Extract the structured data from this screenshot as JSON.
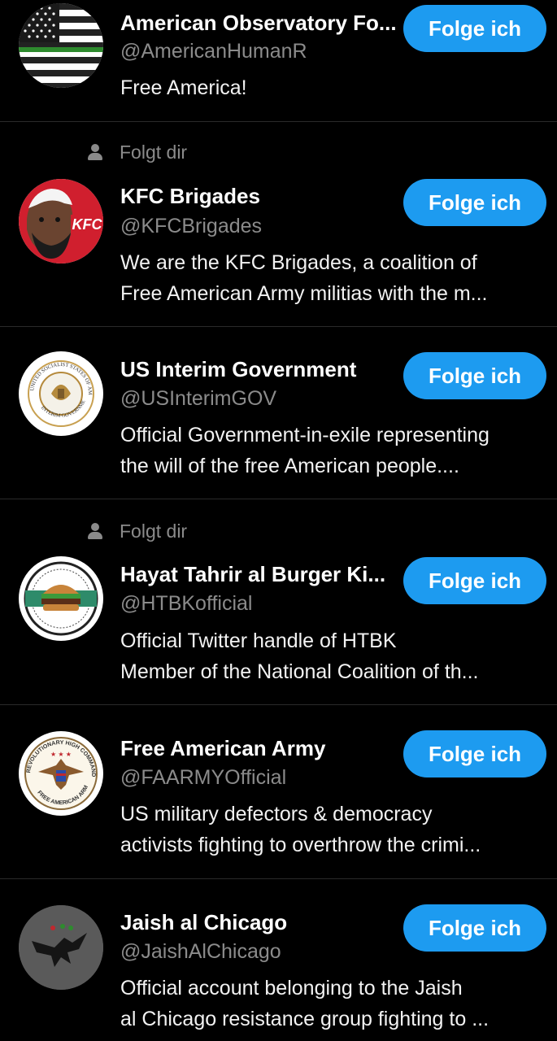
{
  "follows_you_label": "Folgt dir",
  "colors": {
    "background": "#000000",
    "button": "#1d9bf0",
    "secondary_text": "#8b8b8b",
    "divider": "#2a2a2a"
  },
  "accounts": [
    {
      "name": "American Observatory Fo...",
      "handle": "@AmericanHumanR",
      "bio": [
        "Free America!"
      ],
      "follows_you": false,
      "button_label": "Folge ich",
      "avatar_icon": "us-flag-green-line-icon"
    },
    {
      "name": "KFC Brigades",
      "handle": "@KFCBrigades",
      "bio": [
        "We are the KFC Brigades, a coalition of",
        "Free American Army militias with the m..."
      ],
      "follows_you": true,
      "button_label": "Folge ich",
      "avatar_icon": "kfc-logo-icon",
      "avatar_text": "KFC"
    },
    {
      "name": "US Interim Government",
      "handle": "@USInterimGOV",
      "bio": [
        "Official Government-in-exile representing",
        "the will of the free American people...."
      ],
      "follows_you": false,
      "button_label": "Folge ich",
      "avatar_icon": "interim-government-seal-icon",
      "avatar_text": [
        "UNITED SOCIALIST STATES OF AMERICA",
        "INTERIM GOVERNMENT"
      ]
    },
    {
      "name": "Hayat Tahrir al Burger Ki...",
      "handle": "@HTBKofficial",
      "bio": [
        "Official Twitter handle of HTBK",
        "Member of the National Coalition of th..."
      ],
      "follows_you": true,
      "button_label": "Folge ich",
      "avatar_icon": "burger-emblem-icon"
    },
    {
      "name": "Free American Army",
      "handle": "@FAARMYOfficial",
      "bio": [
        "US military defectors & democracy",
        "activists fighting to overthrow the crimi..."
      ],
      "follows_you": false,
      "button_label": "Folge ich",
      "avatar_icon": "eagle-emblem-icon",
      "avatar_text": [
        "REVOLUTIONARY HIGH COMMAND",
        "FREE AMERICAN ARMY"
      ]
    },
    {
      "name": "Jaish al Chicago",
      "handle": "@JaishAlChicago",
      "bio": [
        "Official account belonging to the Jaish",
        "al Chicago resistance group fighting to ..."
      ],
      "follows_you": false,
      "button_label": "Folge ich",
      "avatar_icon": "eagle-silhouette-icon"
    }
  ]
}
